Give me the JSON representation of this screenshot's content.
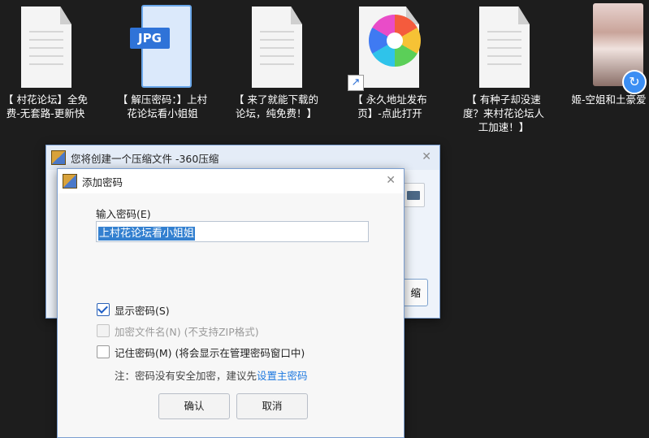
{
  "desktop": {
    "items": [
      {
        "label": "【 村花论坛】全免费-无套路-更新快",
        "icon": "text-document-icon"
      },
      {
        "label": "【 解压密码：】上村花论坛看小姐姐",
        "icon": "jpg-image-icon",
        "badge": "JPG"
      },
      {
        "label": "【 来了就能下载的论坛，纯免费！】",
        "icon": "text-document-icon"
      },
      {
        "label": "【 永久地址发布页】-点此打开",
        "icon": "browser-shortcut-icon"
      },
      {
        "label": "【 有种子却没速度？来村花论坛人工加速！】",
        "icon": "text-document-icon"
      },
      {
        "label": "姬-空姐和土豪爱",
        "icon": "video-thumbnail-icon"
      }
    ]
  },
  "outer_window": {
    "title": "您将创建一个压缩文件 -360压缩",
    "action_label": "缩"
  },
  "password_dialog": {
    "title": "添加密码",
    "password_label": "输入密码(E)",
    "password_value": "上村花论坛看小姐姐",
    "show_password": {
      "label": "显示密码(S)",
      "checked": true
    },
    "encrypt_filenames": {
      "label": "加密文件名(N) (不支持ZIP格式)",
      "checked": false,
      "disabled": true
    },
    "remember_password": {
      "label": "记住密码(M) (将会显示在管理密码窗口中)",
      "checked": false
    },
    "note_prefix": "注：密码没有安全加密，建议先",
    "note_link": "设置主密码",
    "ok_label": "确认",
    "cancel_label": "取消"
  },
  "colors": {
    "accent": "#1f7ae0",
    "selection": "#3380d0"
  }
}
